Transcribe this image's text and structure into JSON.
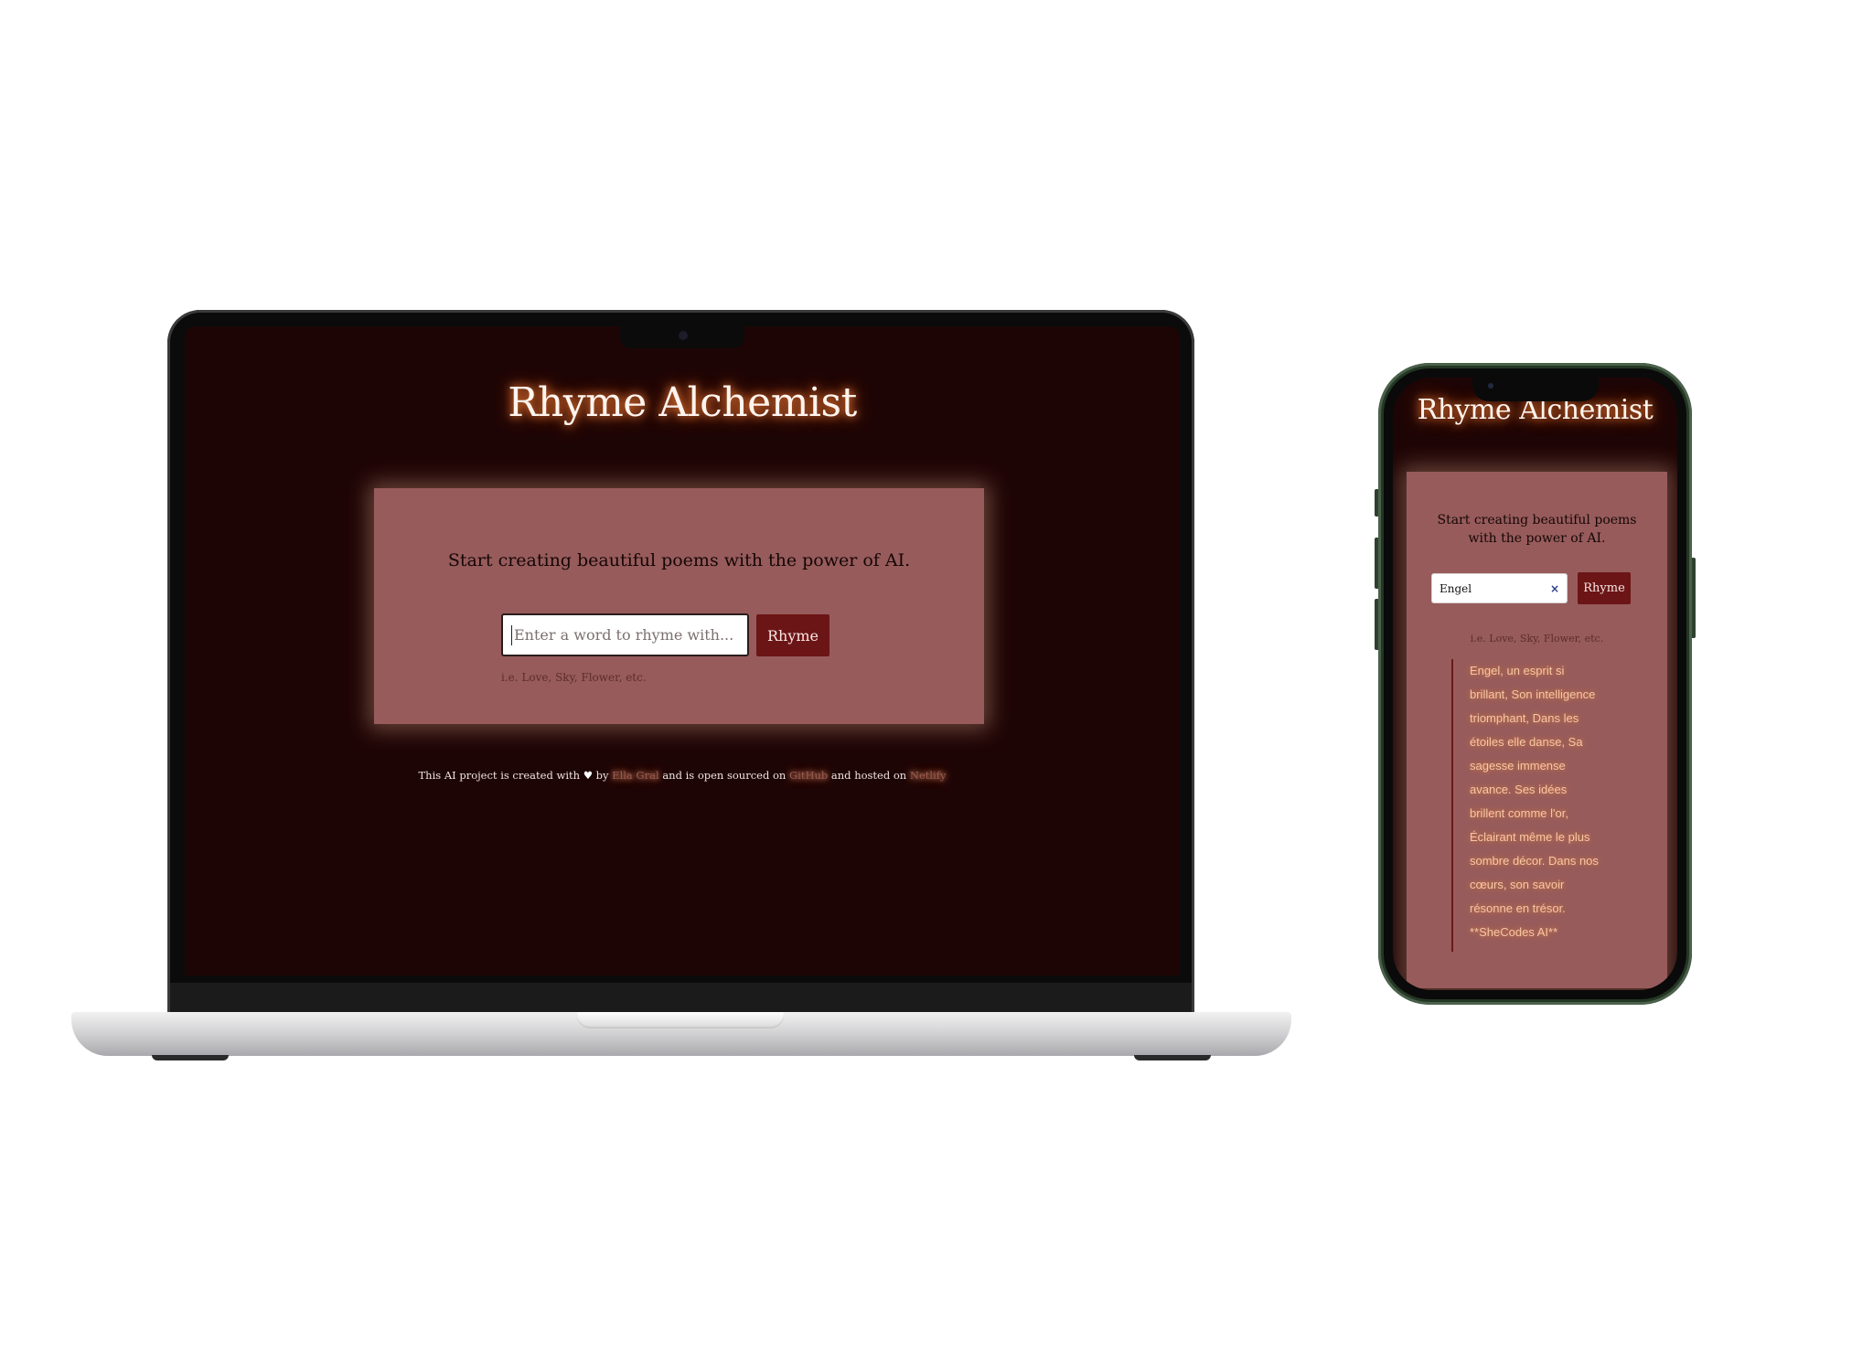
{
  "app": {
    "title": "Rhyme Alchemist",
    "tagline": "Start creating beautiful poems with the power of AI.",
    "input_placeholder": "Enter a word to rhyme with...",
    "button_label": "Rhyme",
    "hint": "i.e. Love, Sky, Flower, etc."
  },
  "footer": {
    "part1": "This AI project is created with",
    "heart": "♥",
    "part2": "by",
    "author": "Ella Gral",
    "part3": "and is open sourced on",
    "github": "GitHub",
    "part4": "and hosted on",
    "netlify": "Netlify"
  },
  "phone": {
    "input_value": "Engel",
    "clear_icon": "×",
    "poem": "Engel, un esprit si brillant, Son intelligence triomphant, Dans les étoiles elle danse, Sa sagesse immense avance. Ses idées brillent comme l'or, Éclairant même le plus sombre décor. Dans nos cœurs, son savoir résonne en trésor. **SheCodes AI**"
  },
  "colors": {
    "background": "#1e0505",
    "card": "#975b5b",
    "button": "#6c1516",
    "title_glow": "#ff8a3c"
  }
}
